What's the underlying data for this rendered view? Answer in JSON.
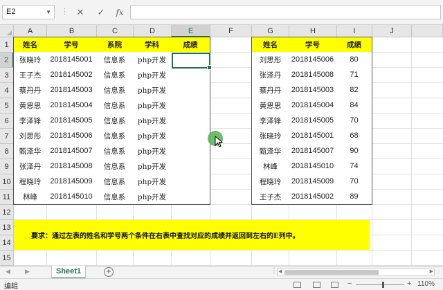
{
  "formula_bar": {
    "name_box": "E2",
    "name_dropdown_icon": "chevron-down-icon",
    "separator": "⋮",
    "cancel_icon": "✕",
    "enter_icon": "✓",
    "fx_icon": "fx",
    "formula": ""
  },
  "columns": [
    "A",
    "B",
    "C",
    "D",
    "E",
    "F",
    "G",
    "H",
    "I",
    "J"
  ],
  "rows": [
    "1",
    "2",
    "3",
    "4",
    "5",
    "6",
    "7",
    "8",
    "9",
    "10",
    "11",
    "12",
    "13",
    "14",
    "15"
  ],
  "left_table": {
    "headers": [
      "姓名",
      "学号",
      "系院",
      "学科",
      "成绩"
    ],
    "rows": [
      [
        "张晓玲",
        "2018145001",
        "信息系",
        "php开发",
        ""
      ],
      [
        "王子杰",
        "2018145002",
        "信息系",
        "php开发",
        ""
      ],
      [
        "蔡丹丹",
        "2018145003",
        "信息系",
        "php开发",
        ""
      ],
      [
        "黄思思",
        "2018145004",
        "信息系",
        "php开发",
        ""
      ],
      [
        "李泽锋",
        "2018145005",
        "信息系",
        "php开发",
        ""
      ],
      [
        "刘思彤",
        "2018145006",
        "信息系",
        "php开发",
        ""
      ],
      [
        "甄泽华",
        "2018145007",
        "信息系",
        "php开发",
        ""
      ],
      [
        "张泽丹",
        "2018145008",
        "信息系",
        "php开发",
        ""
      ],
      [
        "程晓玲",
        "2018145009",
        "信息系",
        "php开发",
        ""
      ],
      [
        "林峰",
        "2018145010",
        "信息系",
        "php开发",
        ""
      ]
    ]
  },
  "right_table": {
    "headers": [
      "姓名",
      "学号",
      "成绩"
    ],
    "rows": [
      [
        "刘思彤",
        "2018145006",
        "80"
      ],
      [
        "张泽丹",
        "2018145008",
        "71"
      ],
      [
        "蔡丹丹",
        "2018145003",
        "82"
      ],
      [
        "黄思思",
        "2018145004",
        "84"
      ],
      [
        "李泽锋",
        "2018145005",
        "70"
      ],
      [
        "张晓玲",
        "2018145001",
        "68"
      ],
      [
        "甄泽华",
        "2018145007",
        "90"
      ],
      [
        "林峰",
        "2018145010",
        "74"
      ],
      [
        "程晓玲",
        "2018145009",
        "70"
      ],
      [
        "王子杰",
        "2018145002",
        "89"
      ]
    ]
  },
  "note": "要求：通过左表的姓名和学号两个条件在右表中查找对应的成绩并返回到左右的E列中。",
  "sheet_tabs": {
    "prev_icon": "◀",
    "next_icon": "▶",
    "active": "Sheet1",
    "add_icon": "+",
    "dots": "⋮"
  },
  "status": {
    "mode": "编辑",
    "zoom_minus": "−",
    "zoom_plus": "+",
    "zoom": "110%",
    "zoom_fraction": 0.55
  },
  "colors": {
    "accent": "#217346",
    "header_fill": "#ffff00",
    "cursor": "#50b450"
  }
}
